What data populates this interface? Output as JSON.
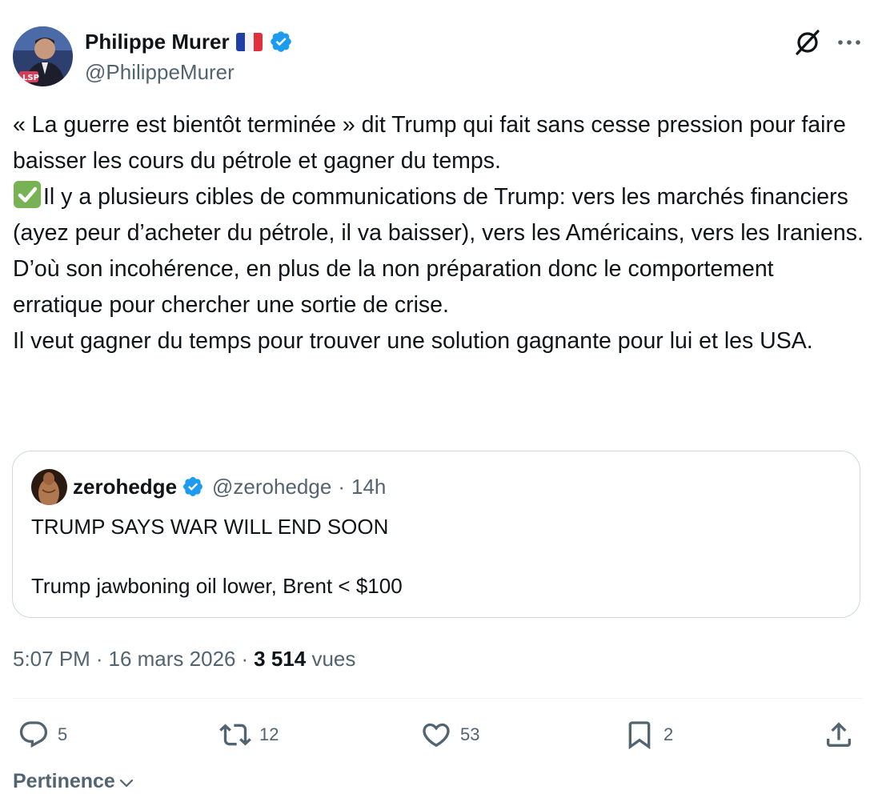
{
  "author": {
    "name": "Philippe Murer",
    "handle": "@PhilippeMurer",
    "flag": "france-flag",
    "verified": true
  },
  "header_icons": [
    "grok-icon",
    "more-icon"
  ],
  "tweet": {
    "lines": [
      "« La guerre est bientôt terminée » dit Trump qui fait sans cesse pression pour faire baisser les cours du pétrole et gagner du temps.",
      "Il y a plusieurs cibles de communications de Trump: vers les marchés financiers (ayez peur d’acheter du pétrole, il va baisser), vers les Américains, vers les Iraniens.",
      "D’où son incohérence, en plus de la non préparation donc le comportement erratique pour chercher une sortie de crise.",
      "Il veut gagner du temps pour trouver une solution gagnante pour lui et les USA."
    ],
    "check_emoji": "check-mark-button-icon"
  },
  "quote": {
    "name": "zerohedge",
    "handle": "@zerohedge",
    "separator": "·",
    "time": "14h",
    "line1": "TRUMP SAYS WAR WILL END SOON",
    "line2": "Trump jawboning oil lower, Brent < $100"
  },
  "meta": {
    "time": "5:07 PM",
    "date": "16 mars 2026",
    "separator": "·",
    "views_count": "3 514",
    "views_label": "vues"
  },
  "actions": {
    "replies": "5",
    "reposts": "12",
    "likes": "53",
    "bookmarks": "2"
  },
  "sort": {
    "label": "Pertinence"
  },
  "colors": {
    "text": "#0f1419",
    "secondary": "#536471",
    "verified": "#1d9bf0",
    "border": "#cfd9de"
  }
}
